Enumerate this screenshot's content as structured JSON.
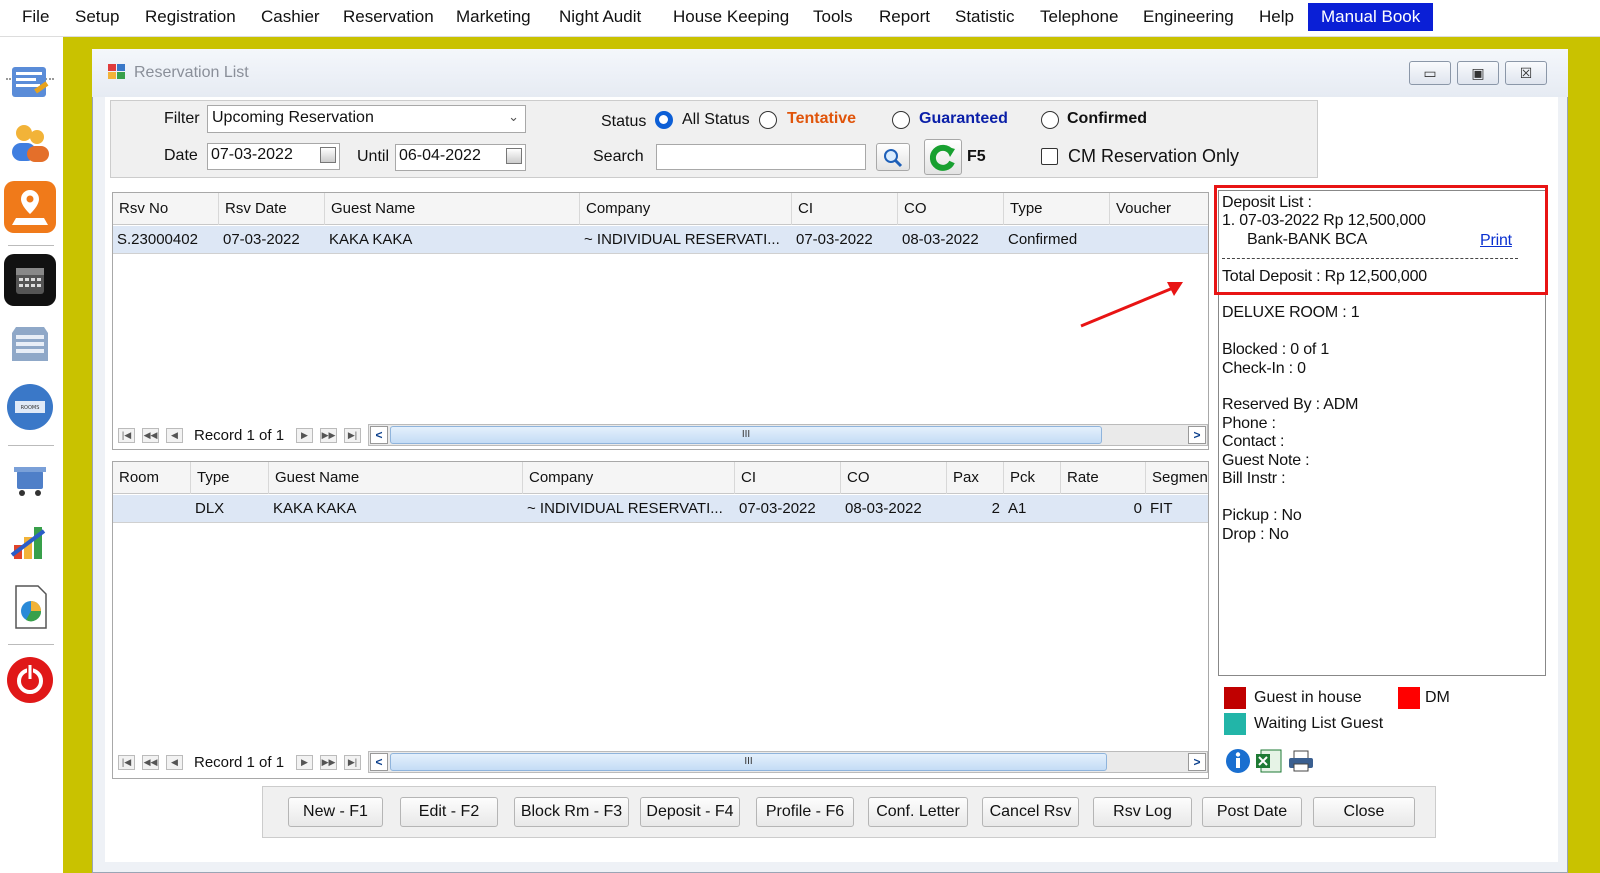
{
  "menu": {
    "items": [
      "File",
      "Setup",
      "Registration",
      "Cashier",
      "Reservation",
      "Marketing",
      "Night Audit",
      "House Keeping",
      "Tools",
      "Report",
      "Statistic",
      "Telephone",
      "Engineering",
      "Help",
      "Manual Book"
    ],
    "active": "Manual Book"
  },
  "window": {
    "title": "Reservation List",
    "minimize": "▭",
    "restore": "▣",
    "close": "☒"
  },
  "filter": {
    "filter_label": "Filter",
    "filter_value": "Upcoming Reservation",
    "date_label": "Date",
    "date_from": "07-03-2022",
    "until_label": "Until",
    "date_to": "06-04-2022",
    "status_label": "Status",
    "status_options": {
      "all": "All Status",
      "tentative": "Tentative",
      "guaranteed": "Guaranteed",
      "confirmed": "Confirmed"
    },
    "search_label": "Search",
    "search_value": "",
    "refresh_label": "F5",
    "cm_only_label": "CM Reservation Only"
  },
  "reservations": {
    "columns": [
      "Rsv No",
      "Rsv Date",
      "Guest Name",
      "Company",
      "CI",
      "CO",
      "Type",
      "Voucher"
    ],
    "rows": [
      [
        "S.23000402",
        "07-03-2022",
        "KAKA KAKA",
        "~ INDIVIDUAL RESERVATI...",
        "07-03-2022",
        "08-03-2022",
        "Confirmed",
        ""
      ]
    ],
    "record_text": "Record 1 of 1",
    "scroll_grip": "III"
  },
  "rooms": {
    "columns": [
      "Room",
      "Type",
      "Guest Name",
      "Company",
      "CI",
      "CO",
      "Pax",
      "Pck",
      "Rate",
      "Segmen"
    ],
    "rows": [
      [
        "",
        "DLX",
        "KAKA KAKA",
        "~ INDIVIDUAL RESERVATI...",
        "07-03-2022",
        "08-03-2022",
        "2",
        "A1",
        "0",
        "FIT"
      ]
    ],
    "record_text": "Record 1 of 1",
    "scroll_grip": "III"
  },
  "info": {
    "deposit_title": "Deposit List :",
    "deposit_line": "1. 07-03-2022   Rp 12,500,000",
    "deposit_bank": "Bank-BANK BCA",
    "print_link": "Print",
    "total_deposit": "Total Deposit : Rp 12,500,000",
    "room_summary": "DELUXE ROOM : 1",
    "blocked": "Blocked : 0 of 1",
    "checkin": "Check-In : 0",
    "reserved_by": "Reserved By : ADM",
    "phone": "Phone :",
    "contact": "Contact :",
    "guest_note": "Guest Note :",
    "bill_instr": "Bill Instr :",
    "pickup": "Pickup : No",
    "drop": "Drop : No"
  },
  "legend": {
    "guest_in_house": "Guest in house",
    "dm": "DM",
    "waiting_list": "Waiting List Guest",
    "colors": {
      "guest_in_house": "#c00000",
      "dm": "#ff0000",
      "waiting_list": "#22b5a8"
    }
  },
  "buttons": [
    "New - F1",
    "Edit - F2",
    "Block Rm - F3",
    "Deposit - F4",
    "Profile  - F6",
    "Conf. Letter",
    "Cancel Rsv",
    "Rsv Log",
    "Post Date",
    "Close"
  ],
  "icons": {
    "info": "info-icon",
    "excel": "excel-icon",
    "printer": "printer-icon"
  },
  "colors": {
    "frame": "#c9c200",
    "menu_active": "#0a1fd6",
    "annotation": "#e81414",
    "tentative": "#e0540a",
    "guaranteed": "#0a1fa8"
  }
}
